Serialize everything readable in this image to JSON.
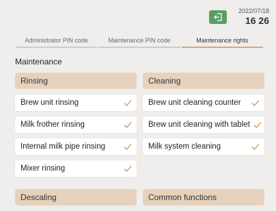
{
  "header": {
    "date": "2022/07/18",
    "time": "16 26",
    "exit_icon": "exit-arrow-icon"
  },
  "tabs": [
    {
      "label": "Administrator PIN code"
    },
    {
      "label": "Maintenance PIN code"
    },
    {
      "label": "Maintenance rights"
    }
  ],
  "section_title": "Maintenance",
  "groups": {
    "rinsing": {
      "title": "Rinsing",
      "items": [
        {
          "label": "Brew unit rinsing",
          "checked": true
        },
        {
          "label": "Milk frother rinsing",
          "checked": true
        },
        {
          "label": "Internal milk pipe rinsing",
          "checked": true
        },
        {
          "label": "Mixer rinsing",
          "checked": true
        }
      ]
    },
    "cleaning": {
      "title": "Cleaning",
      "items": [
        {
          "label": "Brew unit cleaning counter",
          "checked": true
        },
        {
          "label": "Brew unit cleaning with tablet",
          "checked": true
        },
        {
          "label": "Milk system cleaning",
          "checked": true
        }
      ]
    },
    "descaling": {
      "title": "Descaling"
    },
    "common": {
      "title": "Common functions"
    }
  },
  "colors": {
    "accent": "#d6a777",
    "header_bg": "#e6d2bc",
    "exit_btn": "#5a9e63",
    "check": "#e0a35e"
  }
}
